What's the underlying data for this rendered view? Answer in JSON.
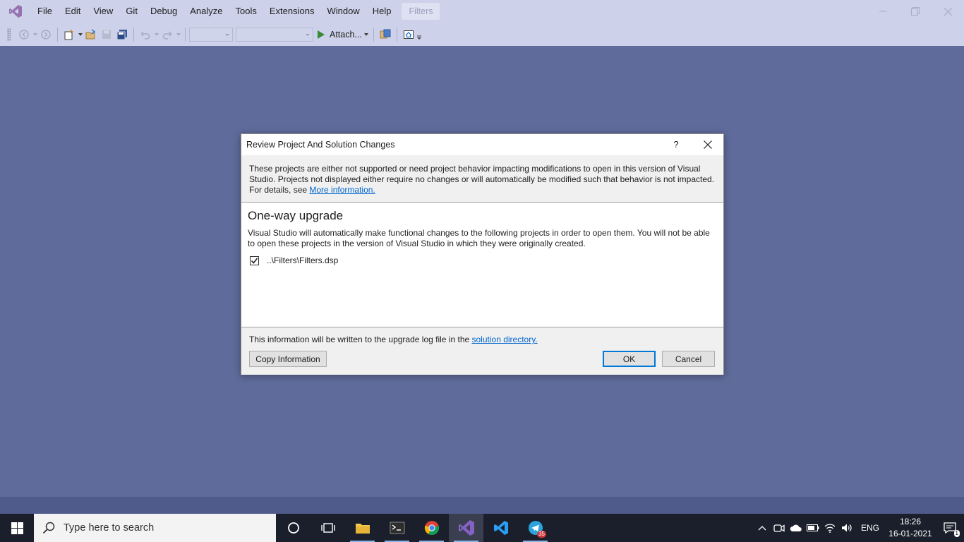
{
  "app": {
    "menu": [
      "File",
      "Edit",
      "View",
      "Git",
      "Debug",
      "Analyze",
      "Tools",
      "Extensions",
      "Window",
      "Help"
    ],
    "solution_name": "Filters"
  },
  "toolbar": {
    "attach_label": "Attach...",
    "icons": [
      "back-icon",
      "forward-icon",
      "new-project-icon",
      "open-icon",
      "save-icon",
      "save-all-icon",
      "undo-icon",
      "redo-icon",
      "start-icon",
      "find-icon",
      "home-icon"
    ]
  },
  "dialog": {
    "title": "Review Project And Solution Changes",
    "help_label": "?",
    "intro_text": "These projects are either not supported or need project behavior impacting modifications to open in this version of Visual Studio. Projects not displayed either require no changes or will automatically be modified such that behavior is not impacted. For details, see ",
    "intro_link": "More information.",
    "section_heading": "One-way upgrade",
    "section_desc": "Visual Studio will automatically make functional changes to the following projects in order to open them. You will not be able to open these projects in the version of Visual Studio in which they were originally created.",
    "projects": [
      {
        "path": "..\\Filters\\Filters.dsp",
        "checked": true
      }
    ],
    "footer_text": "This information will be written to the upgrade log file in the ",
    "footer_link": "solution directory.",
    "copy_button": "Copy Information",
    "ok_button": "OK",
    "cancel_button": "Cancel"
  },
  "taskbar": {
    "search_placeholder": "Type here to search",
    "apps": [
      "cortana-icon",
      "task-view-icon",
      "file-explorer-icon",
      "terminal-icon",
      "chrome-icon",
      "visual-studio-icon",
      "vscode-icon",
      "telegram-icon"
    ],
    "telegram_badge": "35",
    "language": "ENG",
    "time": "18:26",
    "date": "16-01-2021",
    "notification_count": "1"
  },
  "colors": {
    "ide_background": "#5f6b9b",
    "chrome": "#cdd2ea",
    "link": "#0066cc",
    "accent": "#0078d7"
  }
}
